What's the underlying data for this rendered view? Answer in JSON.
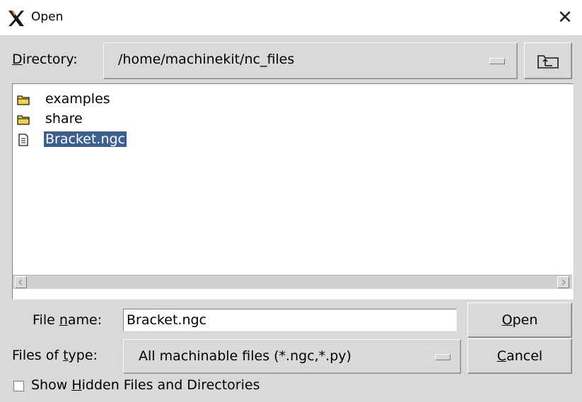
{
  "window": {
    "title": "Open",
    "logo_icon": "x-logo-icon",
    "close_glyph": "✕"
  },
  "directory": {
    "label_accel": "D",
    "label_rest": "irectory:",
    "value": "/home/machinekit/nc_files",
    "up_icon": "folder-up-icon"
  },
  "files": [
    {
      "name": "examples",
      "type": "folder",
      "selected": false
    },
    {
      "name": "share",
      "type": "folder",
      "selected": false
    },
    {
      "name": "Bracket.ngc",
      "type": "file",
      "selected": true
    }
  ],
  "filename": {
    "label_pre": "File ",
    "label_accel": "n",
    "label_post": "ame:",
    "value": "Bracket.ngc"
  },
  "filetype": {
    "label_pre": "Files of ",
    "label_accel": "t",
    "label_post": "ype:",
    "value": "All machinable files (*.ngc,*.py)"
  },
  "buttons": {
    "open_accel": "O",
    "open_rest": "pen",
    "cancel_accel": "C",
    "cancel_rest": "ancel"
  },
  "show_hidden": {
    "label_pre": "Show ",
    "label_accel": "H",
    "label_post": "idden Files and Directories",
    "checked": false
  },
  "colors": {
    "background": "#d9d9d9",
    "selection": "#3c5f8f",
    "folder": "#f2d24a"
  }
}
